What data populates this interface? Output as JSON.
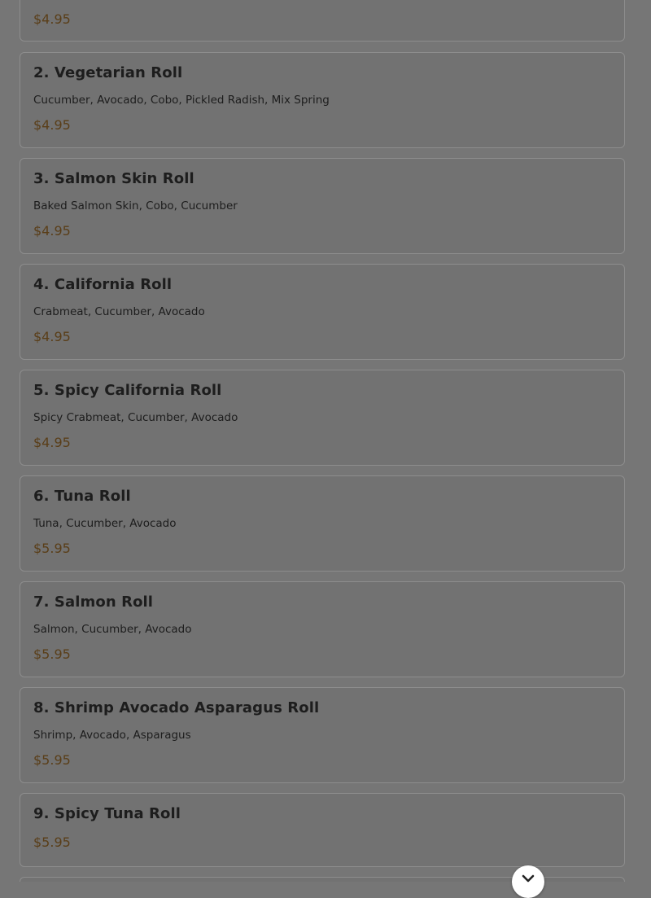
{
  "menu": {
    "items": [
      {
        "name": "",
        "description": "",
        "price": "$4.95"
      },
      {
        "name": "2. Vegetarian Roll",
        "description": "Cucumber, Avocado, Cobo, Pickled Radish, Mix Spring",
        "price": "$4.95"
      },
      {
        "name": "3. Salmon Skin Roll",
        "description": "Baked Salmon Skin, Cobo, Cucumber",
        "price": "$4.95"
      },
      {
        "name": "4. California Roll",
        "description": "Crabmeat, Cucumber, Avocado",
        "price": "$4.95"
      },
      {
        "name": "5. Spicy California Roll",
        "description": "Spicy Crabmeat, Cucumber, Avocado",
        "price": "$4.95"
      },
      {
        "name": "6. Tuna Roll",
        "description": "Tuna, Cucumber, Avocado",
        "price": "$5.95"
      },
      {
        "name": "7. Salmon Roll",
        "description": "Salmon, Cucumber, Avocado",
        "price": "$5.95"
      },
      {
        "name": "8. Shrimp Avocado Asparagus Roll",
        "description": "Shrimp, Avocado, Asparagus",
        "price": "$5.95"
      },
      {
        "name": "9. Spicy Tuna Roll",
        "description": "",
        "price": "$5.95"
      },
      {
        "name": "",
        "description": "",
        "price": ""
      }
    ]
  },
  "scroll_button": {
    "icon": "chevron-down-icon"
  }
}
